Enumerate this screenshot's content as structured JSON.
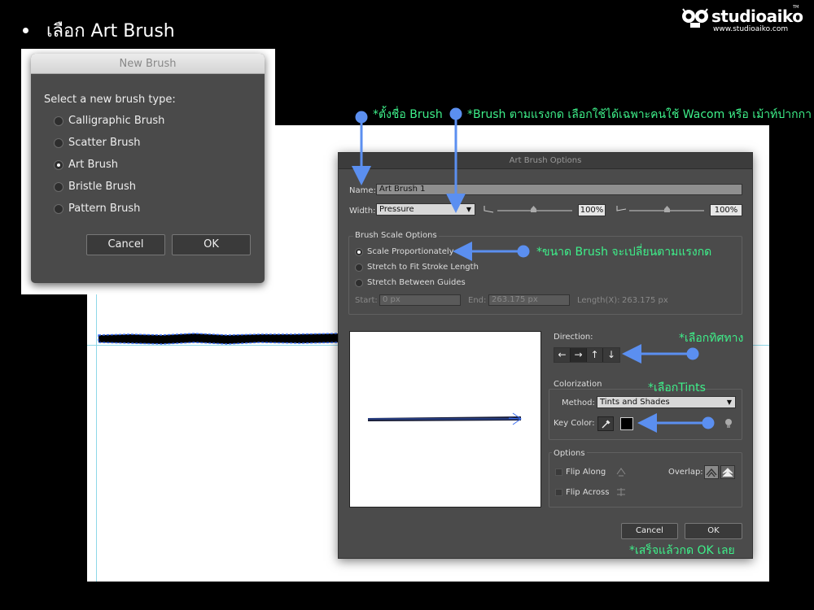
{
  "slide": {
    "title": "เลือก Art Brush",
    "logo_name": "studioaiko",
    "logo_url": "www.studioaiko.com",
    "logo_tm": "TM"
  },
  "new_brush_dialog": {
    "title": "New Brush",
    "prompt": "Select a new brush type:",
    "options": [
      {
        "label": "Calligraphic Brush",
        "selected": false
      },
      {
        "label": "Scatter Brush",
        "selected": false
      },
      {
        "label": "Art Brush",
        "selected": true
      },
      {
        "label": "Bristle Brush",
        "selected": false
      },
      {
        "label": "Pattern Brush",
        "selected": false
      }
    ],
    "cancel_label": "Cancel",
    "ok_label": "OK"
  },
  "art_brush_dialog": {
    "title": "Art Brush Options",
    "name_label": "Name:",
    "name_value": "Art Brush 1",
    "width_label": "Width:",
    "width_value": "Pressure",
    "min_width": "100%",
    "max_width": "100%",
    "scale_group_label": "Brush Scale Options",
    "scale_options": [
      {
        "label": "Scale Proportionately",
        "selected": true
      },
      {
        "label": "Stretch to Fit Stroke Length",
        "selected": false
      },
      {
        "label": "Stretch Between Guides",
        "selected": false
      }
    ],
    "start_label": "Start:",
    "start_value": "0 px",
    "end_label": "End:",
    "end_value": "263.175 px",
    "length_label": "Length(X):",
    "length_value": "263.175 px",
    "direction_label": "Direction:",
    "direction_buttons": [
      "←",
      "→",
      "↑",
      "↓"
    ],
    "colorization_label": "Colorization",
    "method_label": "Method:",
    "method_value": "Tints and Shades",
    "key_color_label": "Key Color:",
    "options_label": "Options",
    "flip_along_label": "Flip Along",
    "flip_across_label": "Flip Across",
    "overlap_label": "Overlap:",
    "cancel_label": "Cancel",
    "ok_label": "OK"
  },
  "annotations": {
    "name_note": "*ตั้งชื่อ Brush",
    "pressure_note": "*Brush ตามแรงกด เลือกใช้ได้เฉพาะคนใช้ Wacom หรือ เม้าท์ปากกา",
    "scale_note": "*ขนาด Brush จะเปลี่ยนตามแรงกด",
    "direction_note": "*เลือกทิศทาง",
    "tints_note": "*เลือกTints",
    "ok_note": "*เสร็จแล้วกด OK เลย"
  },
  "colors": {
    "annotation_text": "#3ef08a",
    "arrow": "#5b8ff0",
    "dialog_bg": "#4b4b4b",
    "guide": "#8fd8e8"
  }
}
